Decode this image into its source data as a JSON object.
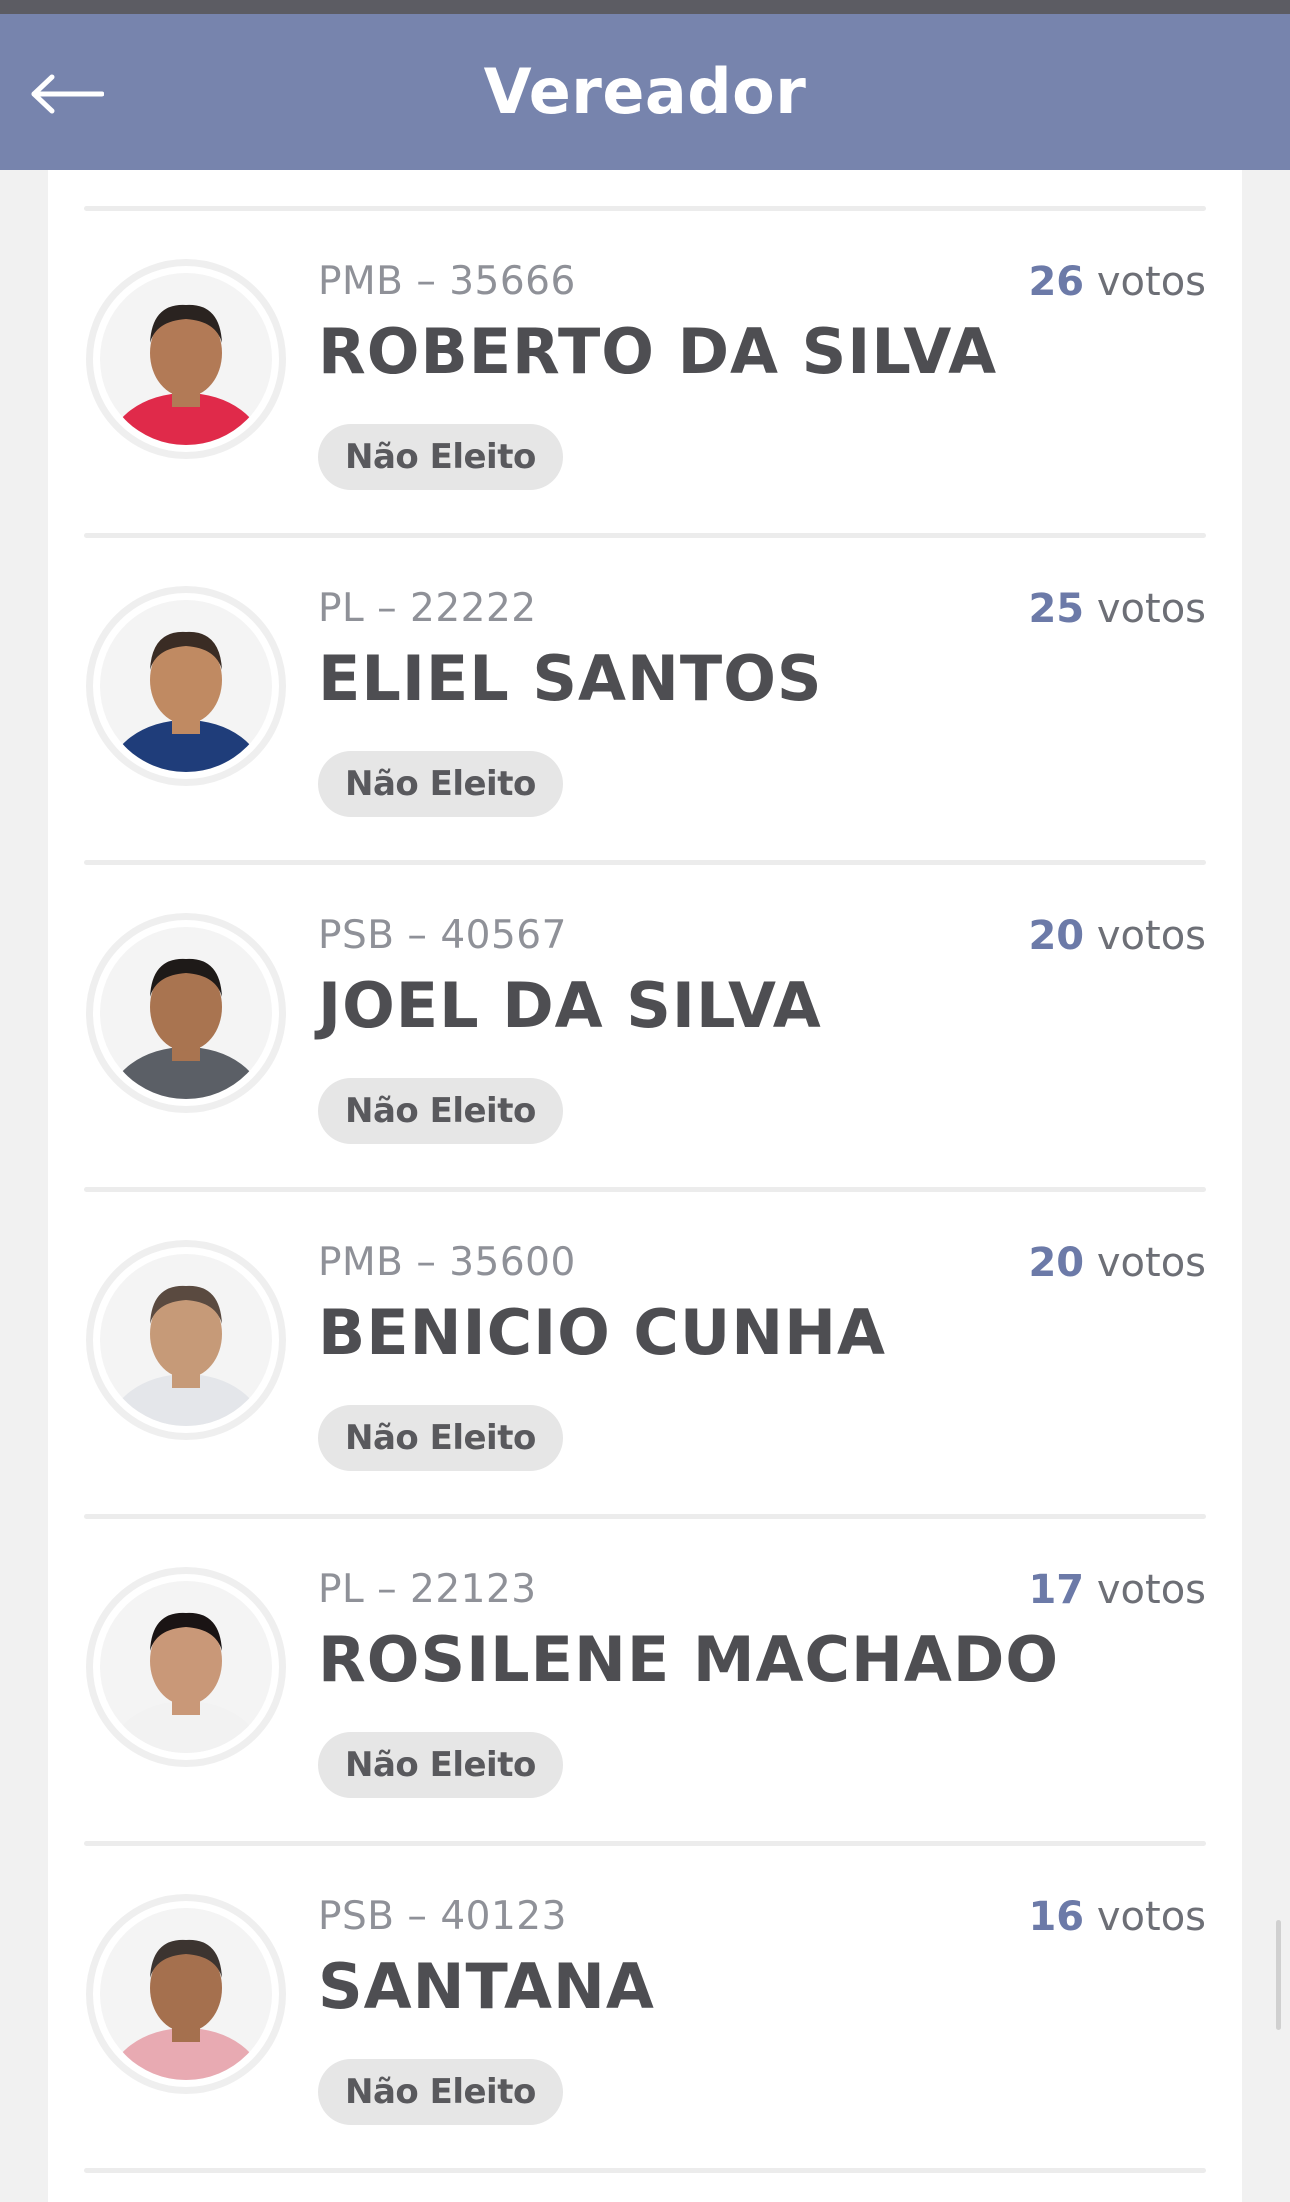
{
  "header": {
    "title": "Vereador",
    "back_icon": "arrow-left-icon"
  },
  "candidates": [
    {
      "party": "PMB – 35666",
      "name": "ROBERTO DA SILVA",
      "status": "Não Eleito",
      "votes": "26",
      "votes_label": "votos",
      "shirt": "#e02a4a",
      "skin": "#b27a56",
      "hair": "#2a2320"
    },
    {
      "party": "PL – 22222",
      "name": "ELIEL SANTOS",
      "status": "Não Eleito",
      "votes": "25",
      "votes_label": "votos",
      "shirt": "#1f3d7a",
      "skin": "#c08a62",
      "hair": "#3a2c24"
    },
    {
      "party": "PSB – 40567",
      "name": "JOEL DA SILVA",
      "status": "Não Eleito",
      "votes": "20",
      "votes_label": "votos",
      "shirt": "#5b5f66",
      "skin": "#a97450",
      "hair": "#1e1a18"
    },
    {
      "party": "PMB – 35600",
      "name": "BENICIO CUNHA",
      "status": "Não Eleito",
      "votes": "20",
      "votes_label": "votos",
      "shirt": "#e4e6ea",
      "skin": "#c69a78",
      "hair": "#5a4a40"
    },
    {
      "party": "PL – 22123",
      "name": "ROSILENE MACHADO",
      "status": "Não Eleito",
      "votes": "17",
      "votes_label": "votos",
      "shirt": "#f2f2f2",
      "skin": "#c99878",
      "hair": "#1a1414"
    },
    {
      "party": "PSB – 40123",
      "name": "SANTANA",
      "status": "Não Eleito",
      "votes": "16",
      "votes_label": "votos",
      "shirt": "#e8aab2",
      "skin": "#a5704e",
      "hair": "#3c3430"
    }
  ]
}
